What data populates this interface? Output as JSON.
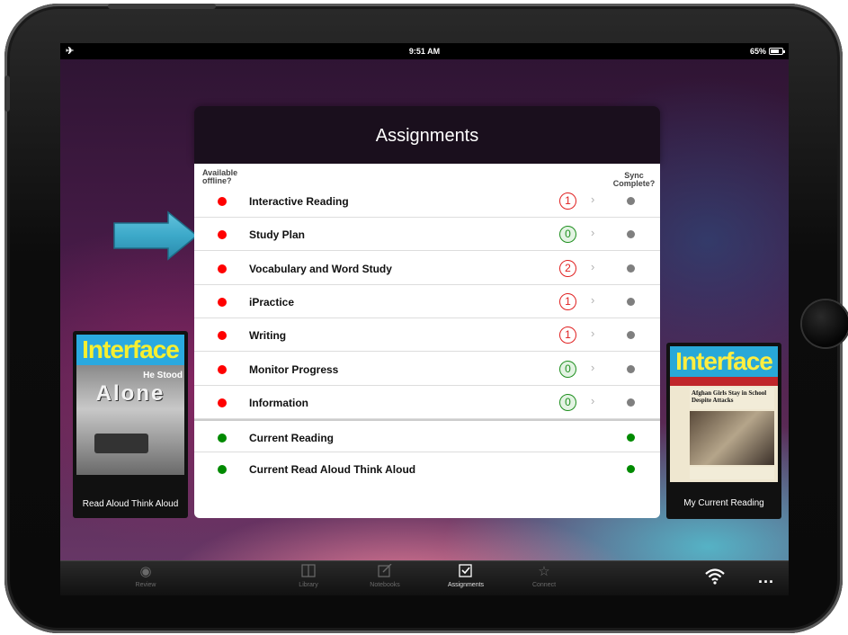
{
  "status_bar": {
    "left_icon": "airplane-icon",
    "time": "9:51 AM",
    "battery": "65%"
  },
  "panel": {
    "title": "Assignments",
    "col_offline": [
      "Available",
      "offline?"
    ],
    "col_sync": [
      "Sync",
      "Complete?"
    ],
    "rows": [
      {
        "label": "Interactive Reading",
        "offline": "red",
        "count": "1",
        "count_color": "red",
        "sync": "grey"
      },
      {
        "label": "Study Plan",
        "offline": "red",
        "count": "0",
        "count_color": "green",
        "sync": "grey"
      },
      {
        "label": "Vocabulary and Word Study",
        "offline": "red",
        "count": "2",
        "count_color": "red",
        "sync": "grey"
      },
      {
        "label": "iPractice",
        "offline": "red",
        "count": "1",
        "count_color": "red",
        "sync": "grey"
      },
      {
        "label": "Writing",
        "offline": "red",
        "count": "1",
        "count_color": "red",
        "sync": "grey"
      },
      {
        "label": "Monitor Progress",
        "offline": "red",
        "count": "0",
        "count_color": "green",
        "sync": "grey"
      },
      {
        "label": "Information",
        "offline": "red",
        "count": "0",
        "count_color": "green",
        "sync": "grey"
      },
      {
        "label": "Current Reading",
        "offline": "green",
        "count": "",
        "count_color": "",
        "sync": "green"
      },
      {
        "label": "Current Read Aloud Think Aloud",
        "offline": "green",
        "count": "",
        "count_color": "",
        "sync": "green"
      }
    ]
  },
  "books": {
    "left": {
      "magazine": "Interface",
      "headline_small": "He Stood",
      "headline_big": "Alone",
      "caption": "Read Aloud Think Aloud"
    },
    "right": {
      "magazine": "Interface",
      "headline": "Afghan Girls Stay in School Despite Attacks",
      "caption": "My Current Reading"
    }
  },
  "tabbar": {
    "tabs": [
      {
        "label": "Review",
        "icon": "eye-icon"
      },
      {
        "label": "Library",
        "icon": "book-icon"
      },
      {
        "label": "Notebooks",
        "icon": "notebook-icon"
      },
      {
        "label": "Assignments",
        "icon": "checkbox-icon"
      },
      {
        "label": "Connect",
        "icon": "star-icon"
      }
    ],
    "more": "...",
    "wifi_icon": "wifi-icon"
  },
  "colors": {
    "red": "#ff0000",
    "green": "#008a00",
    "arrow": "#3ca9c9"
  }
}
